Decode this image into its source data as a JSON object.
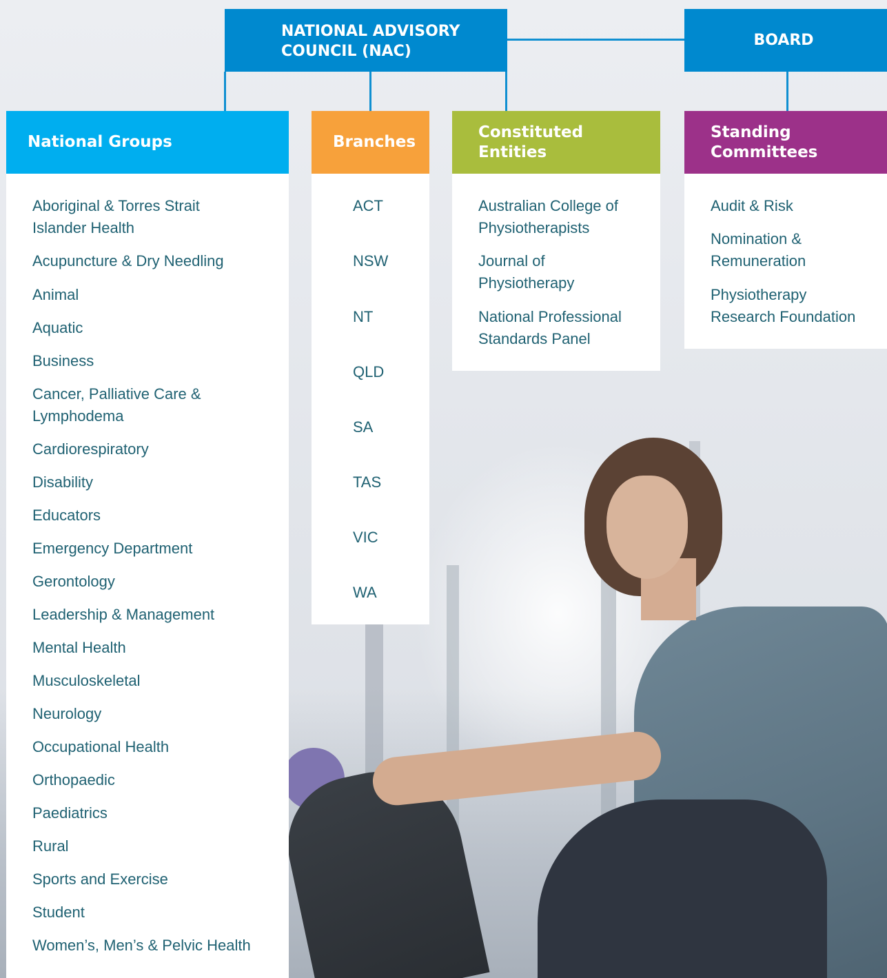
{
  "top": {
    "nac_line1": "NATIONAL ADVISORY",
    "nac_line2": "COUNCIL (NAC)",
    "board": "BOARD"
  },
  "colors": {
    "connector": "#0f8fd1",
    "top_boxes": "#0089cf",
    "national_groups": "#00aeef",
    "branches": "#f7a13b",
    "constituted_entities": "#a9bd3d",
    "standing_committees": "#9c3189",
    "list_text": "#1f6172"
  },
  "national_groups": {
    "title": "National Groups",
    "items": [
      "Aboriginal & Torres Strait",
      "Islander Health",
      "Acupuncture & Dry Needling",
      "Animal",
      "Aquatic",
      "Business",
      "Cancer, Palliative Care &",
      "Lymphodema",
      "Cardiorespiratory",
      "Disability",
      "Educators",
      "Emergency Department",
      "Gerontology",
      "Leadership & Management",
      "Mental Health",
      "Musculoskeletal",
      "Neurology",
      "Occupational Health",
      "Orthopaedic",
      "Paediatrics",
      "Rural",
      "Sports and Exercise",
      "Student",
      "Women’s, Men’s & Pelvic Health"
    ]
  },
  "branches": {
    "title": "Branches",
    "items": [
      "ACT",
      "NSW",
      "NT",
      "QLD",
      "SA",
      "TAS",
      "VIC",
      "WA"
    ]
  },
  "constituted_entities": {
    "title_line1": "Constituted",
    "title_line2": "Entities",
    "items": [
      "Australian College of",
      "Physiotherapists",
      "Journal of",
      "Physiotherapy",
      "National Professional",
      "Standards Panel"
    ]
  },
  "standing_committees": {
    "title_line1": "Standing",
    "title_line2": "Committees",
    "items": [
      "Audit & Risk",
      "Nomination &",
      "Remuneration",
      "Physiotherapy",
      "Research Foundation"
    ]
  }
}
